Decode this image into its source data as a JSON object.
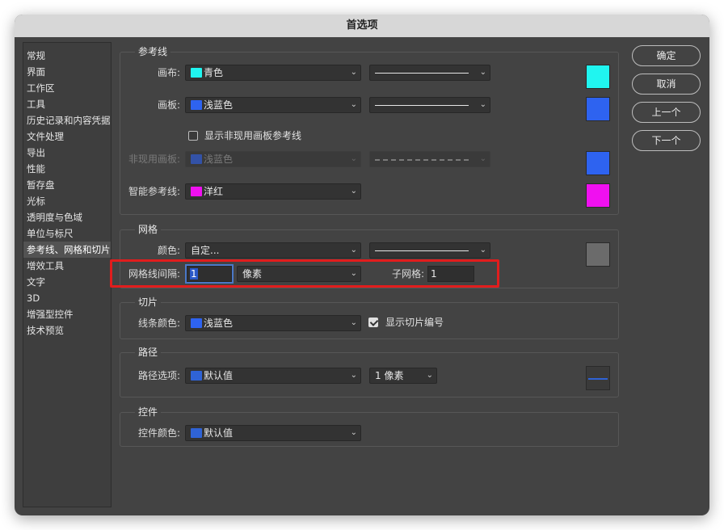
{
  "window": {
    "title": "首选项"
  },
  "sidebar": {
    "items": [
      "常规",
      "界面",
      "工作区",
      "工具",
      "历史记录和内容凭据",
      "文件处理",
      "导出",
      "性能",
      "暂存盘",
      "光标",
      "透明度与色域",
      "单位与标尺",
      "参考线、网格和切片",
      "增效工具",
      "文字",
      "3D",
      "增强型控件",
      "技术预览"
    ],
    "selected_index": 12
  },
  "guides": {
    "title": "参考线",
    "canvas": {
      "label": "画布:",
      "color_name": "青色",
      "color": "#20f5f0",
      "style": "solid"
    },
    "artboard": {
      "label": "画板:",
      "color_name": "浅蓝色",
      "color": "#2e63f0",
      "style": "solid"
    },
    "show_inactive_label": "显示非现用画板参考线",
    "show_inactive_checked": false,
    "inactive": {
      "label": "非现用画板:",
      "color_name": "浅蓝色",
      "color": "#2e63f0",
      "style": "dashed"
    },
    "smart": {
      "label": "智能参考线:",
      "color_name": "洋红",
      "color": "#f010f0"
    }
  },
  "grid": {
    "title": "网格",
    "color_label": "颜色:",
    "color_value": "自定...",
    "color": "#6b6b6b",
    "style": "solid",
    "spacing_label": "网格线间隔:",
    "spacing_value": "1",
    "unit": "像素",
    "subdiv_label": "子网格:",
    "subdiv_value": "1"
  },
  "slices": {
    "title": "切片",
    "line_color_label": "线条颜色:",
    "line_color_name": "浅蓝色",
    "color": "#2e63f0",
    "show_numbers_label": "显示切片编号",
    "show_numbers_checked": true
  },
  "path": {
    "title": "路径",
    "options_label": "路径选项:",
    "color_name": "默认值",
    "color": "#2f63d6",
    "width": "1 像素"
  },
  "controls": {
    "title": "控件",
    "color_label": "控件颜色:",
    "color_name": "默认值",
    "color": "#2f63d6"
  },
  "buttons": {
    "ok": "确定",
    "cancel": "取消",
    "prev": "上一个",
    "next": "下一个"
  }
}
